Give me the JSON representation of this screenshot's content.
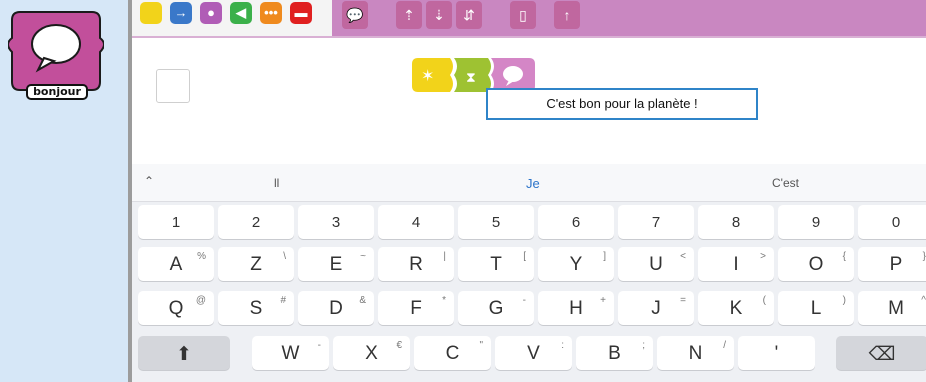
{
  "badge": {
    "label": "bonjour",
    "icon": "speech-bubble-icon",
    "color": "#c24f9b"
  },
  "palette": {
    "categories": [
      {
        "name": "triggers",
        "color": "#f2d31a",
        "glyph": ""
      },
      {
        "name": "motion",
        "color": "#3a78c9",
        "glyph": "→"
      },
      {
        "name": "looks",
        "color": "#b05cb6",
        "glyph": ""
      },
      {
        "name": "sound",
        "color": "#3bb04a",
        "glyph": ""
      },
      {
        "name": "control",
        "color": "#ef8a1e",
        "glyph": ""
      },
      {
        "name": "end",
        "color": "#e02020",
        "glyph": ""
      }
    ],
    "block_icons": [
      "say-icon",
      "grow-icon",
      "shrink-icon",
      "reset-size-icon",
      "hide-icon",
      "show-icon"
    ]
  },
  "canvas": {
    "script_blocks": [
      "start-on-bump-icon",
      "wait-icon",
      "say-icon"
    ],
    "speech_text": "C'est bon pour la planète !"
  },
  "keyboard": {
    "suggestions": {
      "left": "ll",
      "center": "Je",
      "right": "C'est"
    },
    "numbers": [
      "1",
      "2",
      "3",
      "4",
      "5",
      "6",
      "7",
      "8",
      "9",
      "0"
    ],
    "row1": [
      {
        "k": "A",
        "s": "%"
      },
      {
        "k": "Z",
        "s": "\\"
      },
      {
        "k": "E",
        "s": "~"
      },
      {
        "k": "R",
        "s": "|"
      },
      {
        "k": "T",
        "s": "["
      },
      {
        "k": "Y",
        "s": "]"
      },
      {
        "k": "U",
        "s": "<"
      },
      {
        "k": "I",
        "s": ">"
      },
      {
        "k": "O",
        "s": "{"
      },
      {
        "k": "P",
        "s": "}"
      }
    ],
    "row2": [
      {
        "k": "Q",
        "s": "@"
      },
      {
        "k": "S",
        "s": "#"
      },
      {
        "k": "D",
        "s": "&"
      },
      {
        "k": "F",
        "s": "*"
      },
      {
        "k": "G",
        "s": "-"
      },
      {
        "k": "H",
        "s": "+"
      },
      {
        "k": "J",
        "s": "="
      },
      {
        "k": "K",
        "s": "("
      },
      {
        "k": "L",
        "s": ")"
      },
      {
        "k": "M",
        "s": "^"
      }
    ],
    "row3": [
      {
        "k": "W",
        "s": "-"
      },
      {
        "k": "X",
        "s": "€"
      },
      {
        "k": "C",
        "s": "\""
      },
      {
        "k": "V",
        "s": ":"
      },
      {
        "k": "B",
        "s": ";"
      },
      {
        "k": "N",
        "s": "/"
      },
      {
        "k": "'",
        "s": ""
      }
    ]
  }
}
